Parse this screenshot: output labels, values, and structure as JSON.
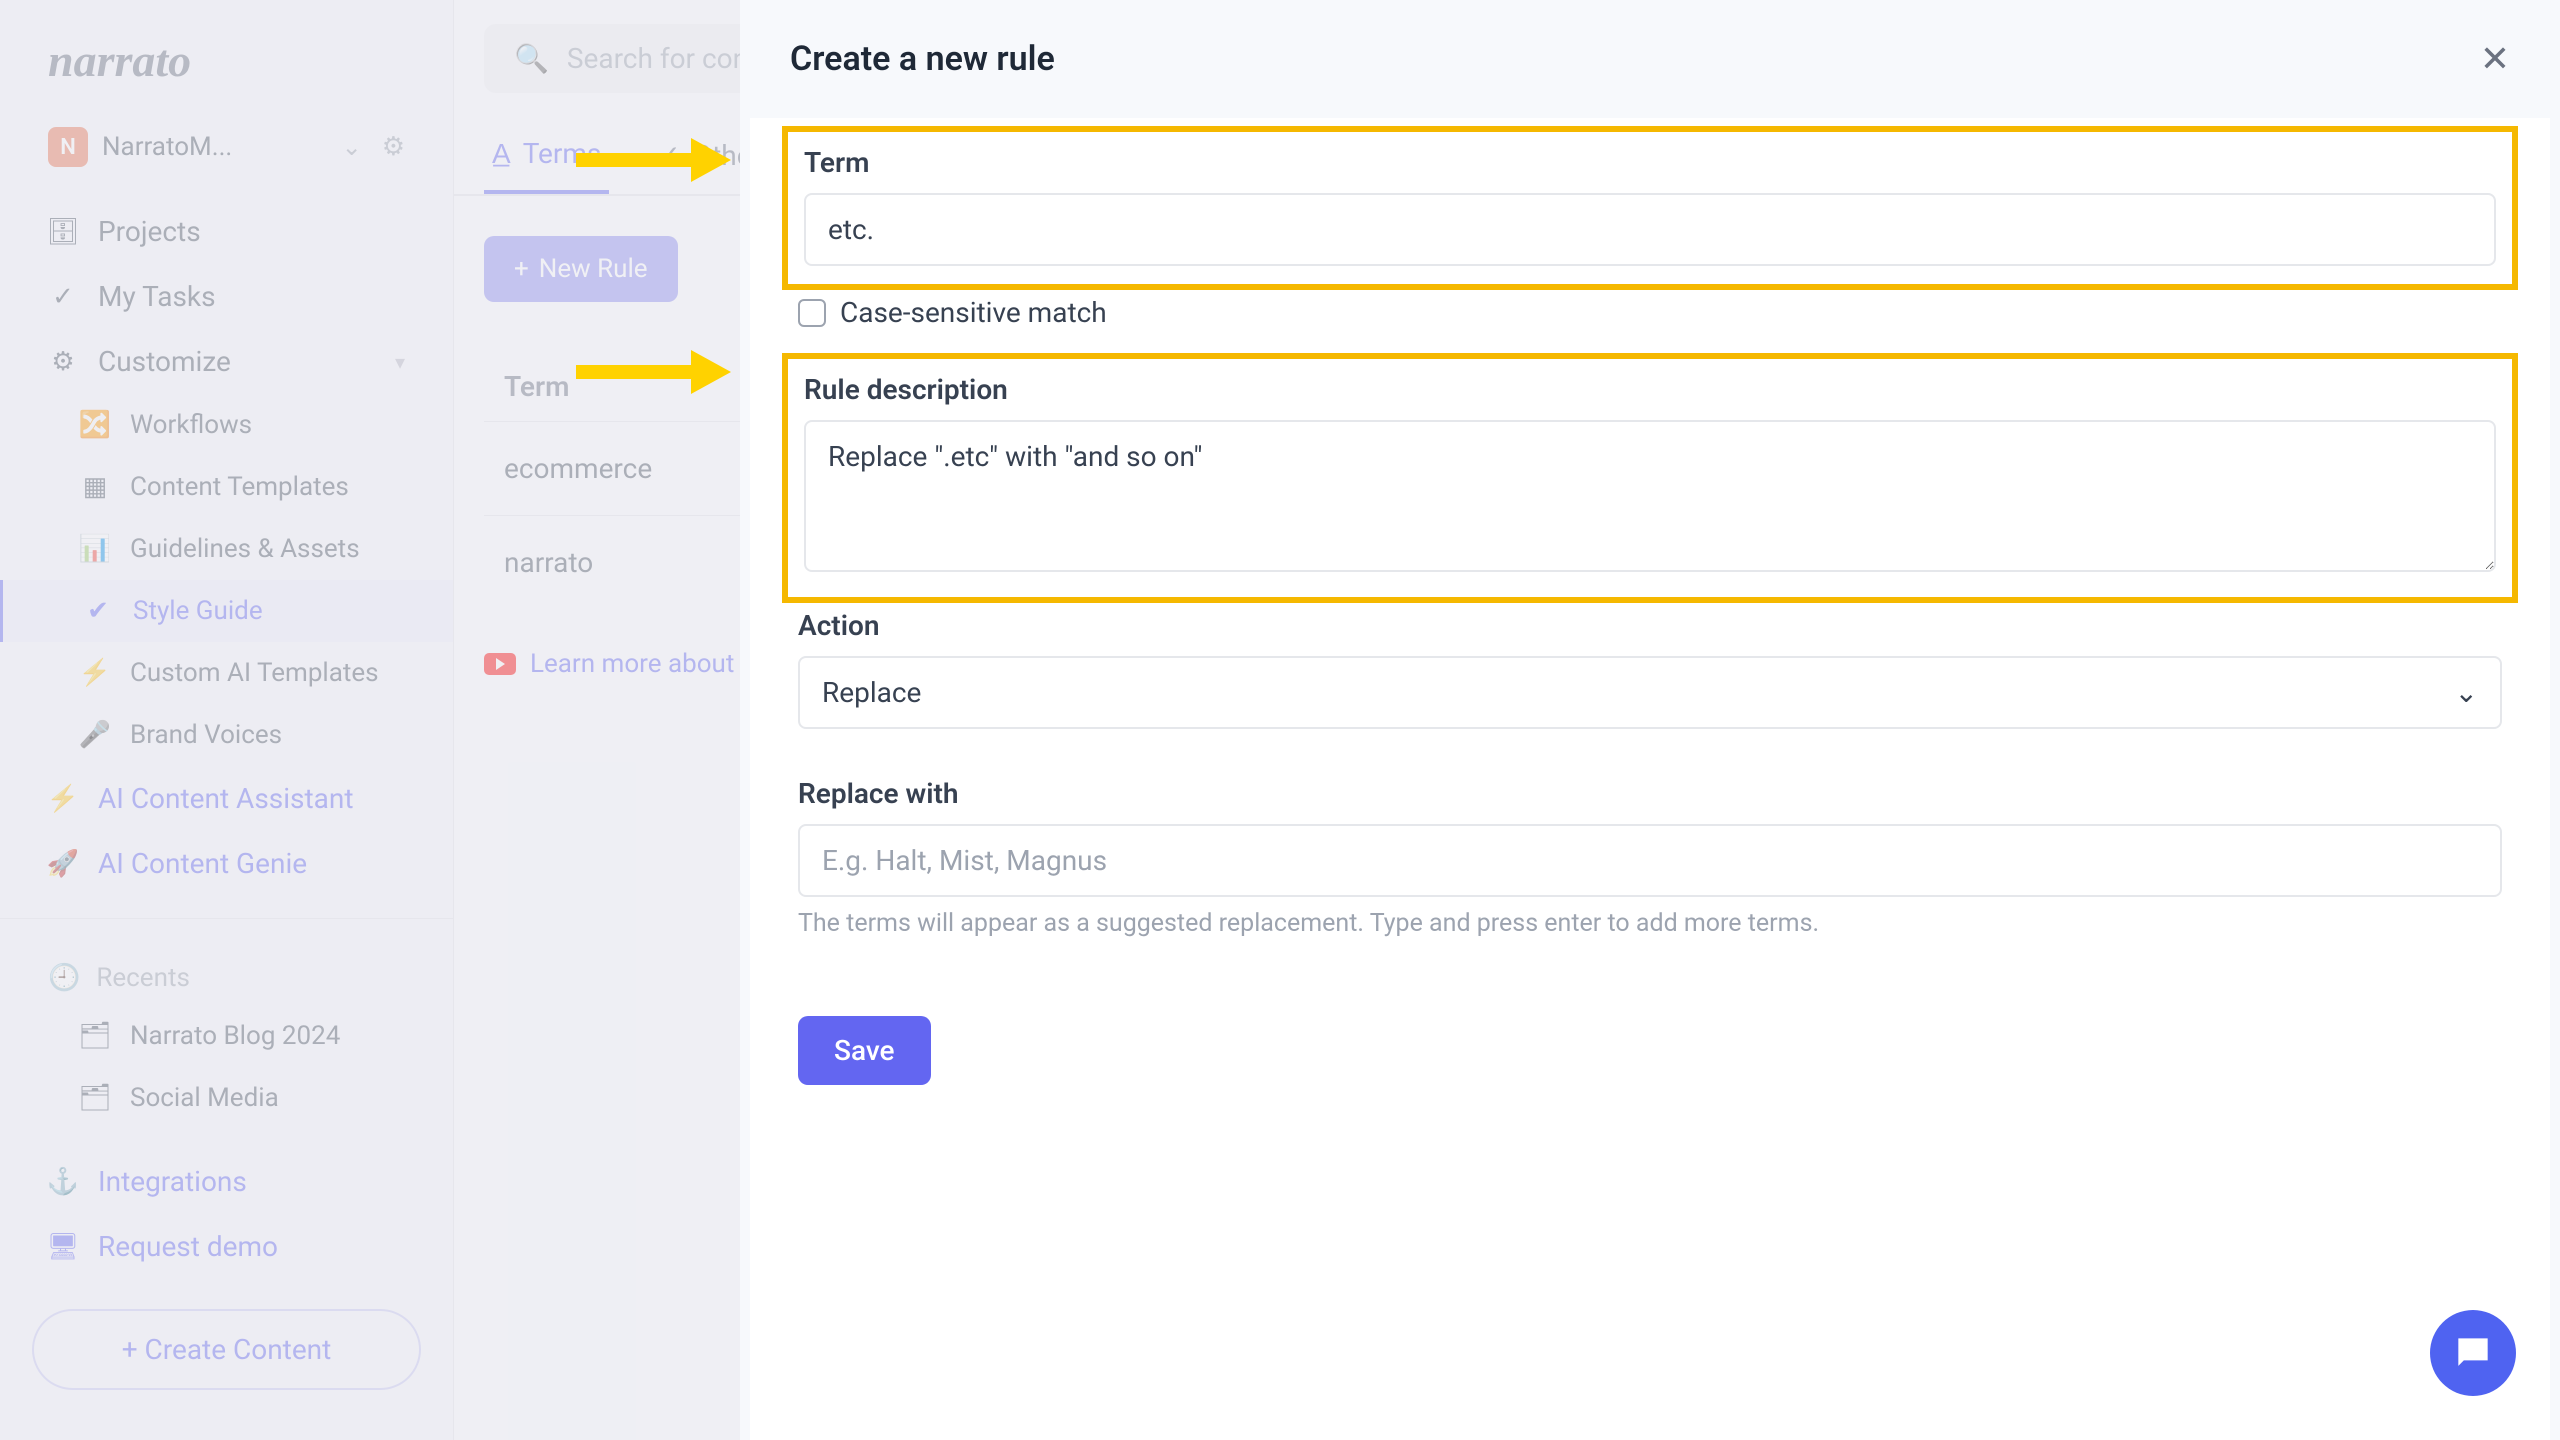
{
  "brand": "narrato",
  "workspace": {
    "initial": "N",
    "name": "NarratoM..."
  },
  "search": {
    "placeholder": "Search for content"
  },
  "sidebar": {
    "projects": "Projects",
    "my_tasks": "My Tasks",
    "customize": "Customize",
    "workflows": "Workflows",
    "content_templates": "Content Templates",
    "guidelines": "Guidelines & Assets",
    "style_guide": "Style Guide",
    "custom_ai": "Custom AI Templates",
    "brand_voices": "Brand Voices",
    "ai_assistant": "AI Content Assistant",
    "ai_genie": "AI Content Genie",
    "recents": "Recents",
    "recent_items": [
      "Narrato Blog 2024",
      "Social Media"
    ],
    "integrations": "Integrations",
    "request_demo": "Request demo",
    "create_content": "+ Create Content"
  },
  "tabs": {
    "terms": "Terms",
    "other": "Other"
  },
  "toolbar": {
    "new_rule": "New Rule"
  },
  "table": {
    "header": "Term",
    "rows": [
      "ecommerce",
      "narrato"
    ]
  },
  "learn_more": "Learn more about",
  "modal": {
    "title": "Create a new rule",
    "term_label": "Term",
    "term_value": "etc.",
    "case_label": "Case-sensitive match",
    "desc_label": "Rule description",
    "desc_value": "Replace \".etc\" with \"and so on\"",
    "action_label": "Action",
    "action_value": "Replace",
    "replace_label": "Replace with",
    "replace_placeholder": "E.g. Halt, Mist, Magnus",
    "helper": "The terms will appear as a suggested replacement. Type and press enter to add more terms.",
    "save": "Save"
  }
}
